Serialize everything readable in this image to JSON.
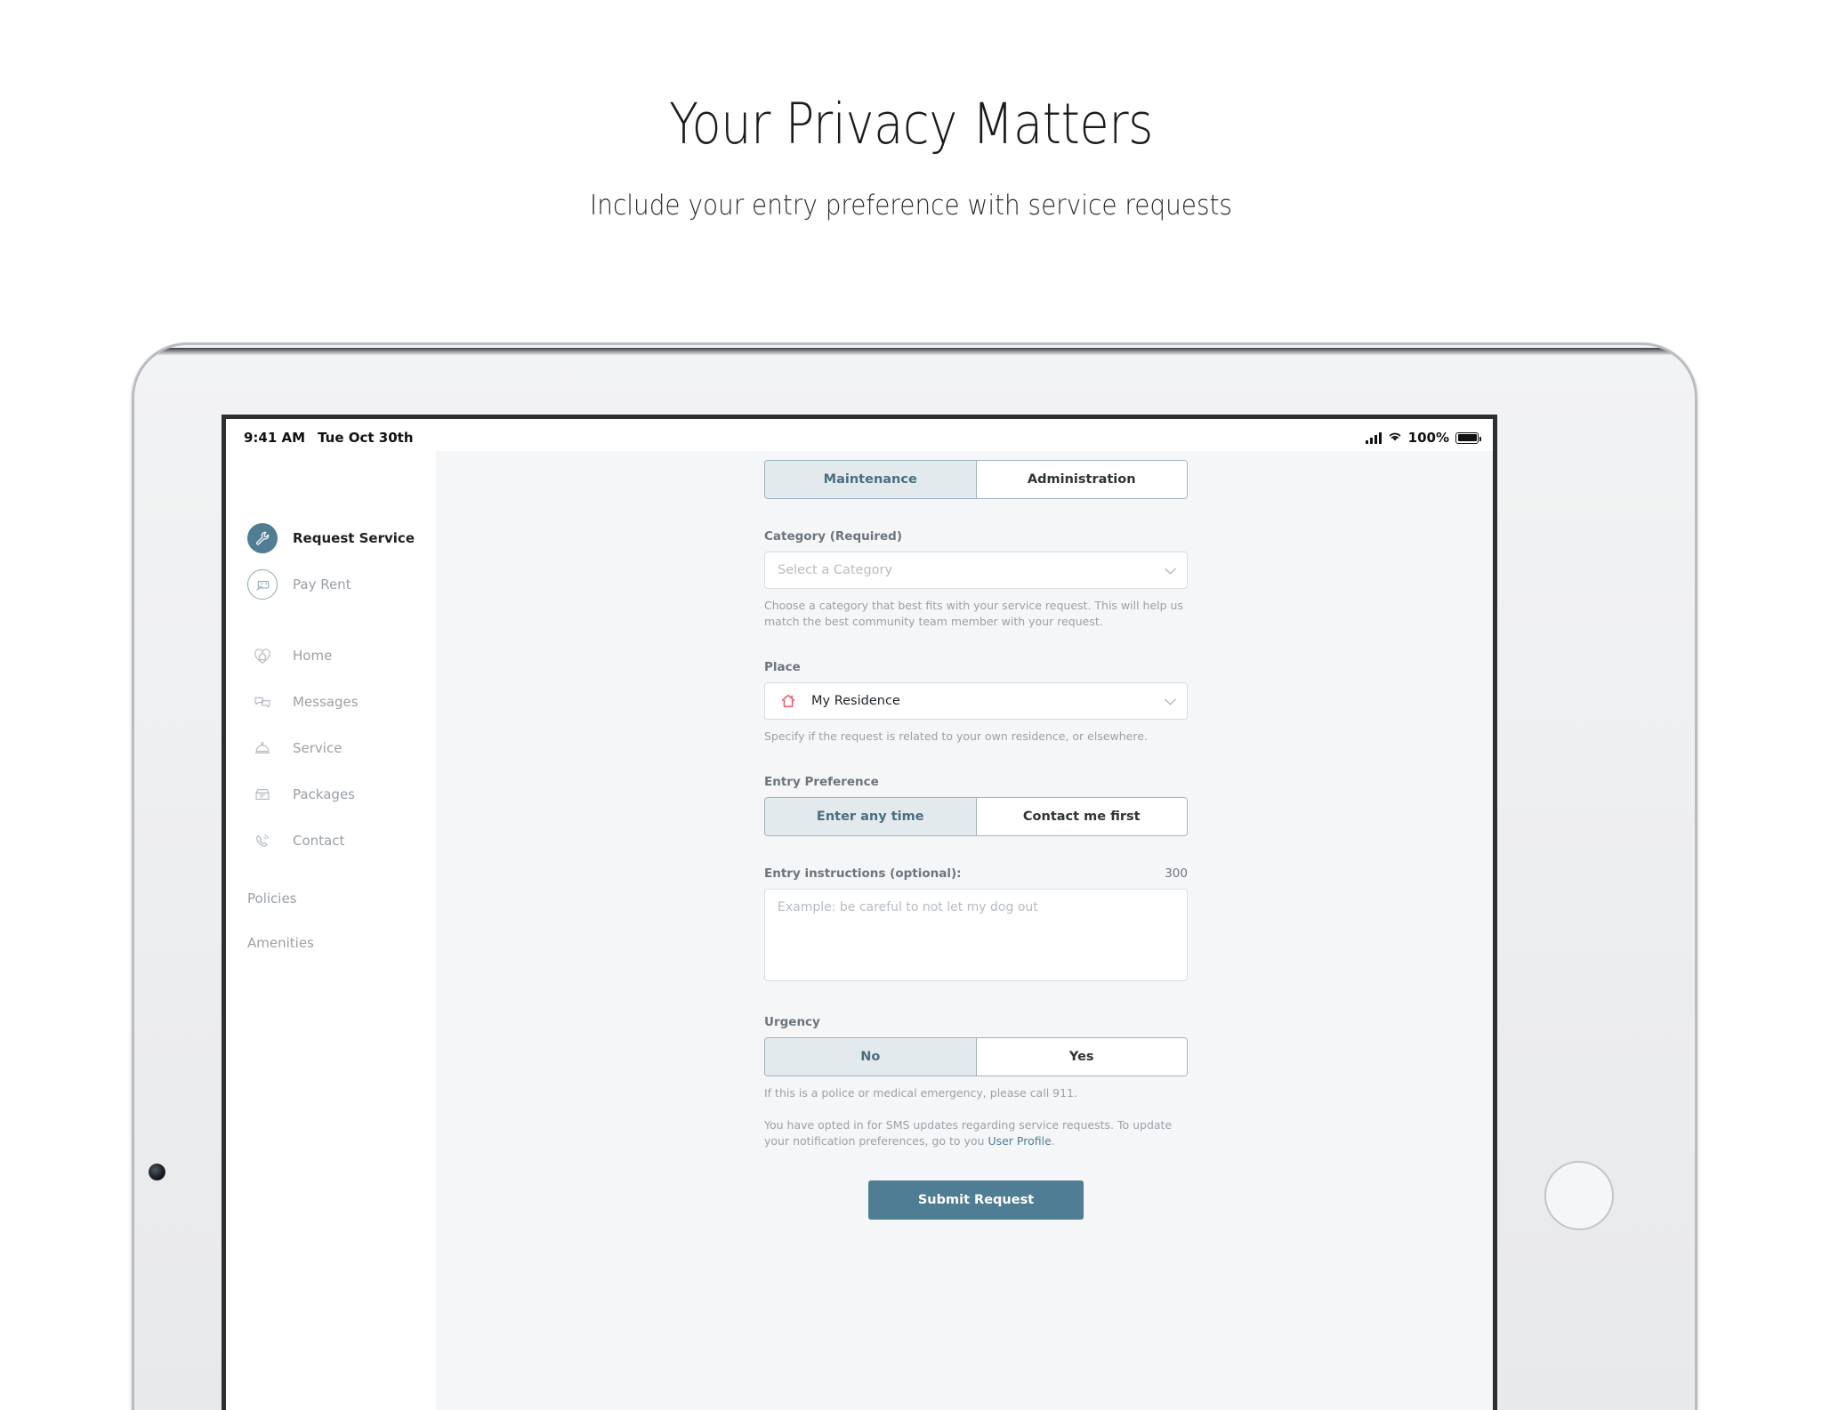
{
  "hero": {
    "title": "Your Privacy Matters",
    "subtitle": "Include your entry preference with service requests"
  },
  "statusbar": {
    "time": "9:41 AM",
    "date": "Tue Oct 30th",
    "battery_percent": "100%",
    "icons": [
      "cellular-signal-icon",
      "wifi-icon",
      "battery-icon"
    ]
  },
  "sidebar": {
    "primary": [
      {
        "label": "Request Service",
        "icon": "wrench-icon",
        "active": true
      },
      {
        "label": "Pay Rent",
        "icon": "hand-card-icon",
        "active": false
      }
    ],
    "secondary": [
      {
        "label": "Home",
        "icon": "heart-house-icon"
      },
      {
        "label": "Messages",
        "icon": "chat-bubbles-icon"
      },
      {
        "label": "Service",
        "icon": "service-bell-icon"
      },
      {
        "label": "Packages",
        "icon": "package-box-icon"
      },
      {
        "label": "Contact",
        "icon": "phone-icon"
      }
    ],
    "links": [
      {
        "label": "Policies"
      },
      {
        "label": "Amenities"
      }
    ]
  },
  "form": {
    "type_tabs": {
      "options": [
        "Maintenance",
        "Administration"
      ],
      "selected": "Maintenance"
    },
    "category": {
      "label": "Category (Required)",
      "placeholder": "Select a Category",
      "helper": "Choose a category that best fits with your service request. This will help us match the best community team member with your request."
    },
    "place": {
      "label": "Place",
      "value": "My Residence",
      "icon": "house-outline-icon",
      "helper": "Specify if the request is related to your own residence, or elsewhere."
    },
    "entry_preference": {
      "label": "Entry Preference",
      "options": [
        "Enter any time",
        "Contact me first"
      ],
      "selected": "Enter any time"
    },
    "entry_instructions": {
      "label": "Entry instructions (optional):",
      "counter": "300",
      "placeholder": "Example: be careful to not let my dog out",
      "value": ""
    },
    "urgency": {
      "label": "Urgency",
      "options": [
        "No",
        "Yes"
      ],
      "selected": "No",
      "helper": "If this is a police or medical emergency, please call 911."
    },
    "sms_notice": {
      "text_before": "You have opted in for SMS updates regarding service requests. To update your notification preferences, go to you ",
      "link": "User Profile",
      "text_after": "."
    },
    "submit_label": "Submit Request"
  },
  "colors": {
    "accent": "#4f7d93",
    "segment_active_bg": "#e3eaee",
    "house_icon": "#e8485f",
    "page_bg": "#f4f6f8"
  }
}
